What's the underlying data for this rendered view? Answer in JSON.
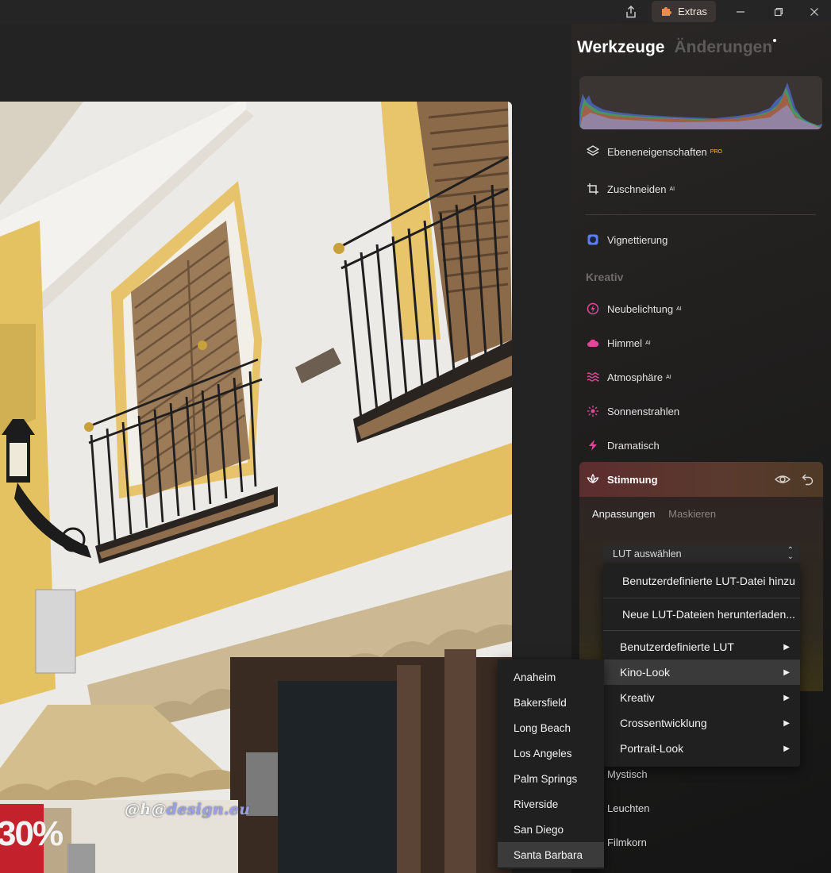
{
  "titlebar": {
    "extras_label": "Extras",
    "icons": [
      "share-icon",
      "puzzle-icon",
      "minimize-icon",
      "restore-icon",
      "close-icon"
    ]
  },
  "panel": {
    "tabs": [
      {
        "label": "Werkzeuge",
        "active": true
      },
      {
        "label": "Änderungen",
        "active": false
      }
    ],
    "tools_top": [
      {
        "label": "Ebeneneigenschaften",
        "badge": "PRO",
        "icon": "layers-icon"
      },
      {
        "label": "Zuschneiden",
        "badge": "AI",
        "icon": "crop-icon"
      },
      {
        "label": "Vignettierung",
        "badge": "",
        "icon": "vignette-icon"
      }
    ],
    "section_kreativ": "Kreativ",
    "tools_kreativ": [
      {
        "label": "Neubelichtung",
        "badge": "AI",
        "icon": "relight-icon",
        "color": "#e0479a"
      },
      {
        "label": "Himmel",
        "badge": "AI",
        "icon": "cloud-icon",
        "color": "#e0479a"
      },
      {
        "label": "Atmosphäre",
        "badge": "AI",
        "icon": "waves-icon",
        "color": "#e0479a"
      },
      {
        "label": "Sonnenstrahlen",
        "badge": "",
        "icon": "sun-icon",
        "color": "#e0479a"
      },
      {
        "label": "Dramatisch",
        "badge": "",
        "icon": "lightning-icon",
        "color": "#e0479a"
      }
    ],
    "stimmung": {
      "label": "Stimmung",
      "subtabs": [
        "Anpassungen",
        "Maskieren"
      ],
      "lut_select": "LUT auswählen"
    },
    "lower_tools": [
      "Mystisch",
      "Leuchten",
      "Filmkorn"
    ]
  },
  "lut_menu": {
    "items": [
      {
        "label": "Benutzerdefinierte LUT-Datei hinzu",
        "submenu": false
      },
      {
        "label": "Neue LUT-Dateien herunterladen...",
        "submenu": false
      },
      {
        "label": "Benutzerdefinierte LUT",
        "submenu": true
      },
      {
        "label": "Kino-Look",
        "submenu": true,
        "highlighted": true
      },
      {
        "label": "Kreativ",
        "submenu": true
      },
      {
        "label": "Crossentwicklung",
        "submenu": true
      },
      {
        "label": "Portrait-Look",
        "submenu": true
      }
    ]
  },
  "kino_submenu": {
    "items": [
      "Anaheim",
      "Bakersfield",
      "Long Beach",
      "Los Angeles",
      "Palm Springs",
      "Riverside",
      "San Diego",
      "Santa Barbara"
    ],
    "selected": "Santa Barbara"
  },
  "photo": {
    "watermark_prefix": "@",
    "watermark_h": "h",
    "watermark_at": "@",
    "watermark_domain": "design.eu",
    "sign_text": "30%"
  },
  "colors": {
    "accent_pink": "#e0479a",
    "vignette_blue": "#5b7ff0",
    "pro_badge": "#f2c04a"
  }
}
